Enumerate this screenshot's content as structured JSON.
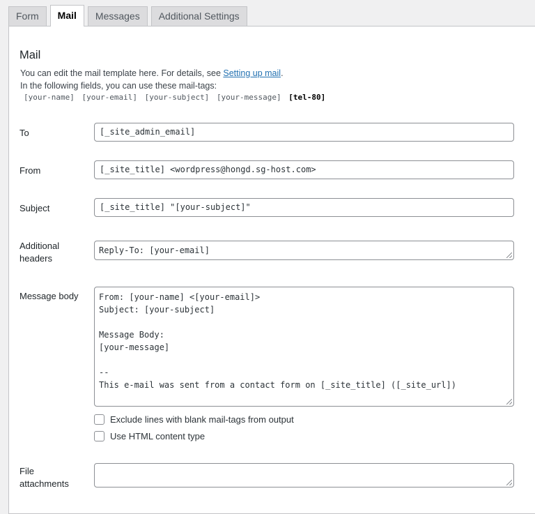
{
  "tabs": [
    "Form",
    "Mail",
    "Messages",
    "Additional Settings"
  ],
  "active_tab": "Mail",
  "section_title": "Mail",
  "description": {
    "line1_prefix": "You can edit the mail template here. For details, see ",
    "line1_link": "Setting up mail",
    "line1_suffix": ".",
    "line2": "In the following fields, you can use these mail-tags:"
  },
  "mail_tags": [
    "[your-name]",
    "[your-email]",
    "[your-subject]",
    "[your-message]"
  ],
  "mail_tag_bold": "[tel-80]",
  "fields": {
    "to": {
      "label": "To",
      "value": "[_site_admin_email]"
    },
    "from": {
      "label": "From",
      "value": "[_site_title] <wordpress@hongd.sg-host.com>"
    },
    "subject": {
      "label": "Subject",
      "value": "[_site_title] \"[your-subject]\""
    },
    "additional_headers": {
      "label_line1": "Additional",
      "label_line2": "headers",
      "value": "Reply-To: [your-email]"
    },
    "message_body": {
      "label": "Message body",
      "lines": [
        "From: [your-name] <[your-email]>",
        "Subject: [your-subject]",
        "",
        "Message Body:",
        "[your-message]",
        "",
        "--",
        "This e-mail was sent from a contact form on [_site_title] ([_site_url])"
      ]
    },
    "file_attachments": {
      "label_line1": "File",
      "label_line2": "attachments",
      "value": ""
    }
  },
  "checkboxes": {
    "exclude_blank": {
      "label": "Exclude lines with blank mail-tags from output",
      "checked": false
    },
    "html_content": {
      "label": "Use HTML content type",
      "checked": false
    }
  }
}
